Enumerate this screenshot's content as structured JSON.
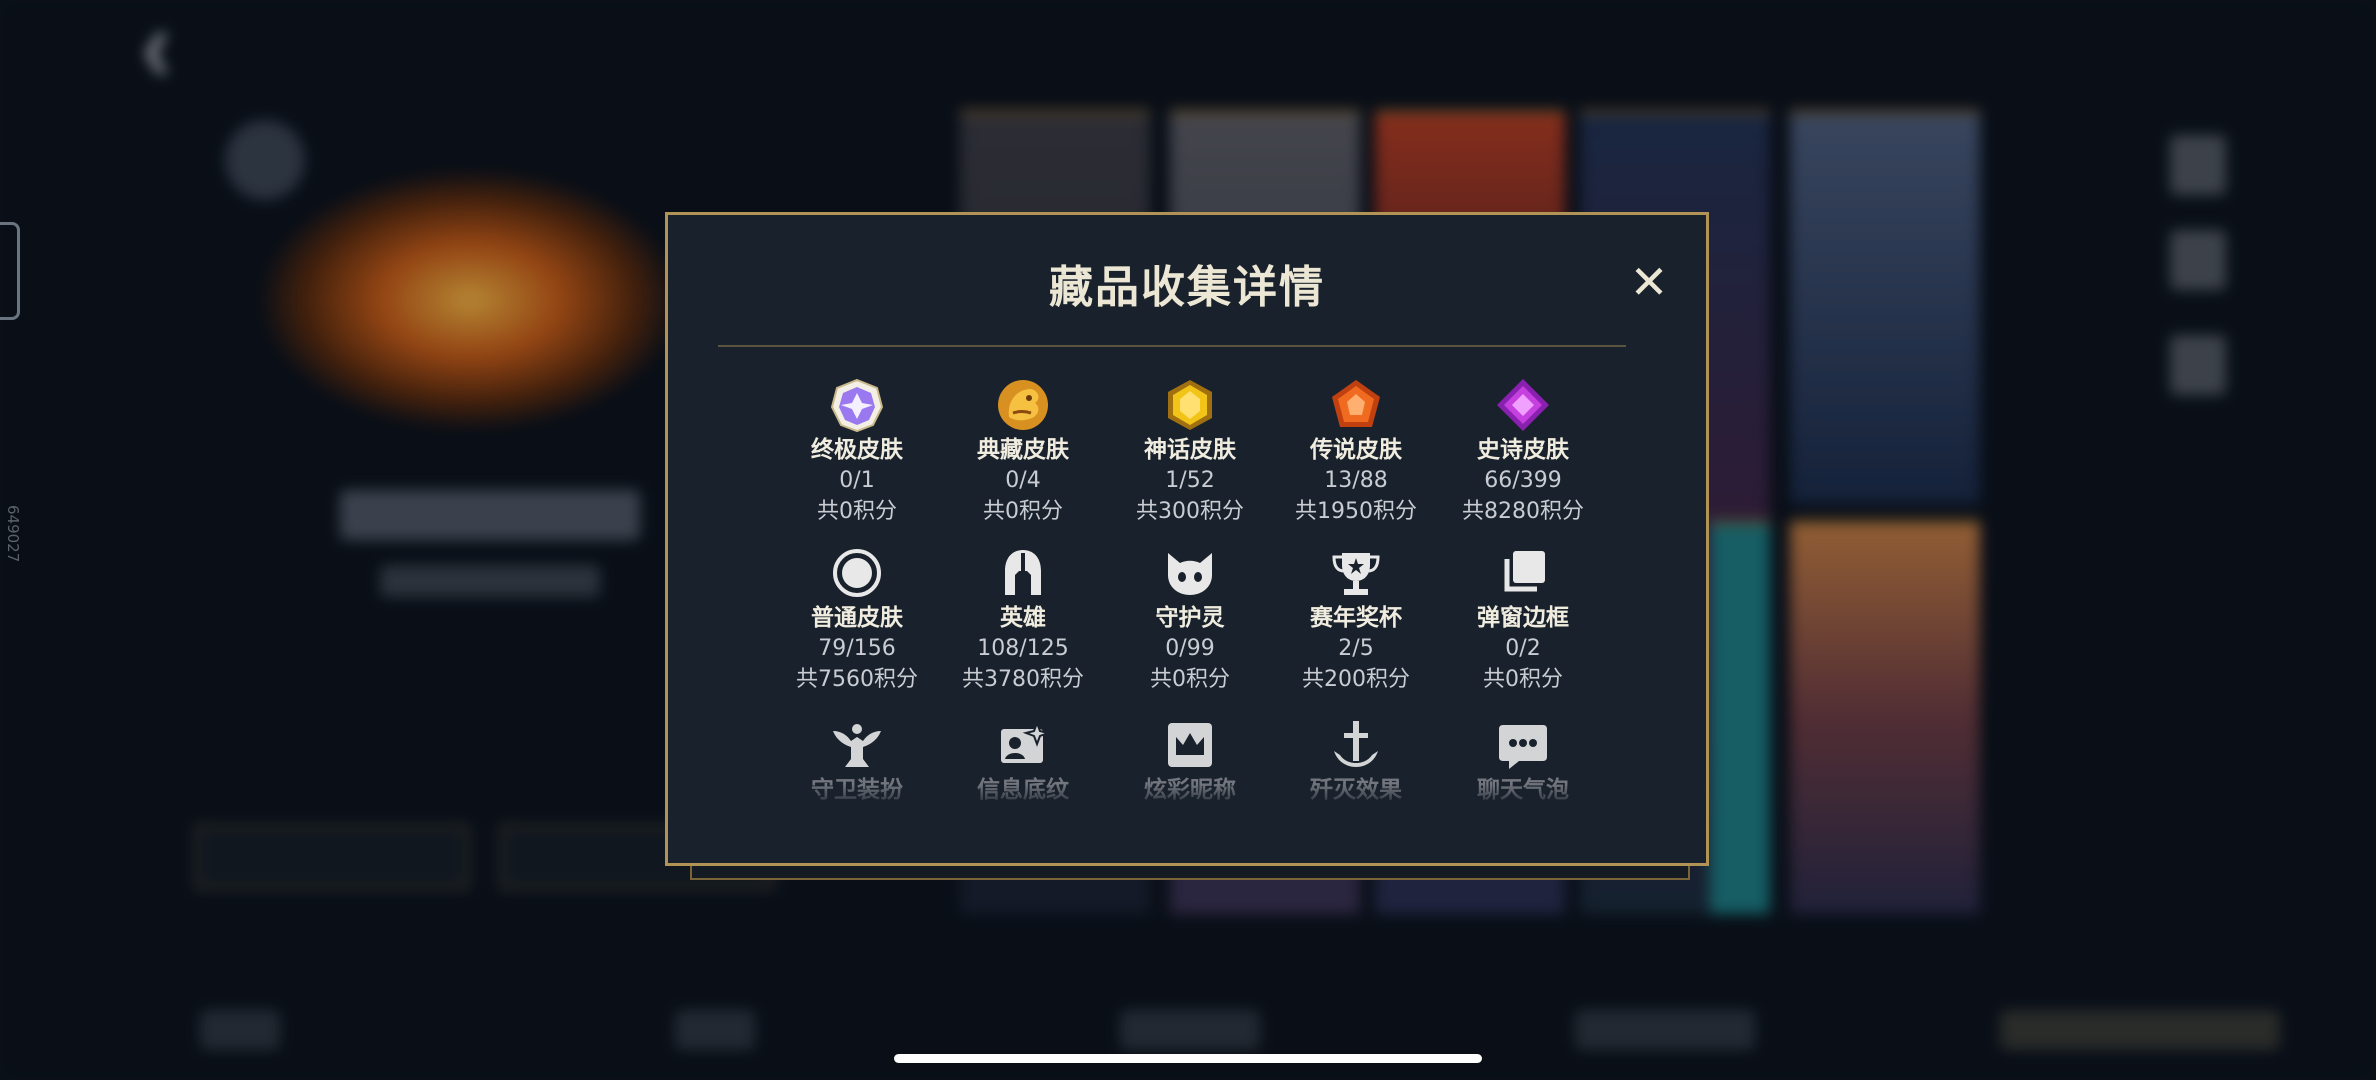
{
  "background": {
    "back_label": "返回",
    "nav_items": []
  },
  "modal": {
    "title": "藏品收集详情",
    "close_symbol": "✕",
    "items": [
      {
        "label": "终极皮肤",
        "count": "0/1",
        "points": "共0积分",
        "icon": "ultimate-gem-icon",
        "color": "#b08cff"
      },
      {
        "label": "典藏皮肤",
        "count": "0/4",
        "points": "共0积分",
        "icon": "dragon-emblem-icon",
        "color": "#f0b030"
      },
      {
        "label": "神话皮肤",
        "count": "1/52",
        "points": "共300积分",
        "icon": "mythic-gem-icon",
        "color": "#f2c418"
      },
      {
        "label": "传说皮肤",
        "count": "13/88",
        "points": "共1950积分",
        "icon": "legendary-gem-icon",
        "color": "#f06a20"
      },
      {
        "label": "史诗皮肤",
        "count": "66/399",
        "points": "共8280积分",
        "icon": "epic-gem-icon",
        "color": "#c640e0"
      },
      {
        "label": "普通皮肤",
        "count": "79/156",
        "points": "共7560积分",
        "icon": "circle-icon",
        "color": "#e8e8e8"
      },
      {
        "label": "英雄",
        "count": "108/125",
        "points": "共3780积分",
        "icon": "helmet-icon",
        "color": "#e8e8e8"
      },
      {
        "label": "守护灵",
        "count": "0/99",
        "points": "共0积分",
        "icon": "spirit-icon",
        "color": "#e8e8e8"
      },
      {
        "label": "赛年奖杯",
        "count": "2/5",
        "points": "共200积分",
        "icon": "trophy-icon",
        "color": "#e8e8e8"
      },
      {
        "label": "弹窗边框",
        "count": "0/2",
        "points": "共0积分",
        "icon": "frame-icon",
        "color": "#e8e8e8"
      },
      {
        "label": "守卫装扮",
        "icon": "ward-icon",
        "color": "#e8e8e8"
      },
      {
        "label": "信息底纹",
        "icon": "card-sparkle-icon",
        "color": "#e8e8e8"
      },
      {
        "label": "炫彩昵称",
        "icon": "crown-name-icon",
        "color": "#e8e8e8"
      },
      {
        "label": "歼灭效果",
        "icon": "anchor-sword-icon",
        "color": "#e8e8e8"
      },
      {
        "label": "聊天气泡",
        "icon": "chat-bubble-icon",
        "color": "#e8e8e8"
      }
    ]
  },
  "side_code": "649027"
}
